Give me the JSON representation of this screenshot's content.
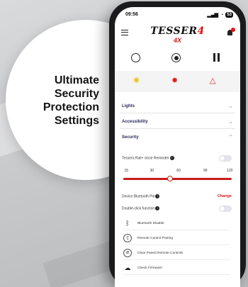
{
  "headline": [
    "Ultimate",
    "Security",
    "Protection",
    "Settings"
  ],
  "status": {
    "time": "09:56",
    "battery": "53"
  },
  "app": {
    "logo_main": "TESSER",
    "logo_num": "4",
    "logo_sub": "4X"
  },
  "sections": {
    "lights": "Lights",
    "accessibility": "Accessibility",
    "security": "Security"
  },
  "security": {
    "close_reminder_label": "Tesserа Rail+ close Reminder",
    "slider_ticks": [
      "15",
      "30",
      "60",
      "90",
      "120"
    ],
    "slider_value": 60,
    "slider_min": 15,
    "slider_max": 120,
    "pin_label": "Device Bluetooth Pin",
    "pin_action": "Change",
    "double_click_label": "Double-click function",
    "actions": [
      {
        "label": "Bluetooth Disable",
        "icon": "bluetooth-icon"
      },
      {
        "label": "Remote Control Pairing",
        "icon": "remote-icon"
      },
      {
        "label": "Clear Paired Remote Controls",
        "icon": "clear-remote-icon"
      },
      {
        "label": "Check Firmware",
        "icon": "cloud-icon"
      }
    ]
  },
  "colors": {
    "accent": "#d11111",
    "yellow": "#f0c419",
    "nav": "#2a2a5a"
  }
}
